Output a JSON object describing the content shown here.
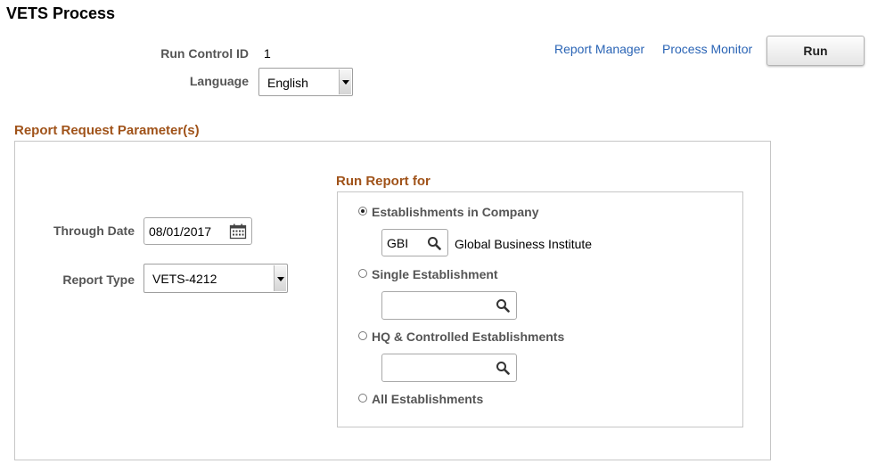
{
  "page": {
    "title": "VETS Process"
  },
  "run_control": {
    "label": "Run Control ID",
    "value": "1"
  },
  "language": {
    "label": "Language",
    "selected": "English"
  },
  "header_links": {
    "report_manager": "Report Manager",
    "process_monitor": "Process Monitor"
  },
  "run_button": {
    "label": "Run"
  },
  "parameters": {
    "title": "Report Request Parameter(s)",
    "through_date": {
      "label": "Through Date",
      "value": "08/01/2017"
    },
    "report_type": {
      "label": "Report Type",
      "selected": "VETS-4212"
    }
  },
  "run_report_for": {
    "title": "Run Report for",
    "options": [
      {
        "label": "Establishments in Company",
        "checked": true
      },
      {
        "label": "Single Establishment",
        "checked": false
      },
      {
        "label": "HQ & Controlled Establishments",
        "checked": false
      },
      {
        "label": "All Establishments",
        "checked": false
      }
    ],
    "company": {
      "code": "GBI",
      "description": "Global Business Institute"
    },
    "single_establishment": {
      "value": ""
    },
    "hq_establishment": {
      "value": ""
    }
  },
  "icons": {
    "calendar": "calendar-icon",
    "lookup": "magnifier-icon",
    "dropdown": "chevron-down-icon"
  }
}
